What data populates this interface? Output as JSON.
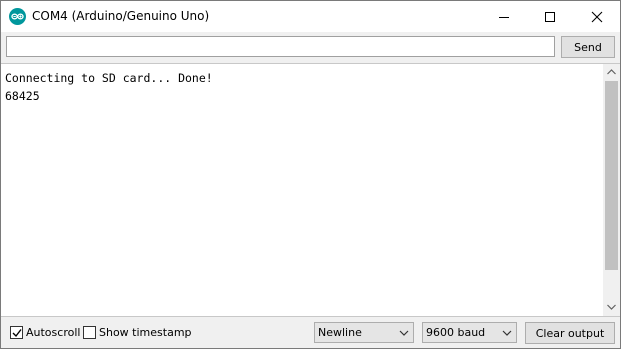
{
  "window": {
    "title": "COM4 (Arduino/Genuino Uno)",
    "icon": "arduino-logo-icon",
    "accent_color": "#00979c"
  },
  "send_bar": {
    "input_value": "",
    "send_label": "Send"
  },
  "output": {
    "lines": [
      "Connecting to SD card... Done!",
      "68425"
    ]
  },
  "bottom_bar": {
    "autoscroll_label": "Autoscroll",
    "autoscroll_checked": true,
    "timestamp_label": "Show timestamp",
    "timestamp_checked": false,
    "line_ending_selected": "Newline",
    "baud_selected": "9600 baud",
    "clear_label": "Clear output"
  }
}
